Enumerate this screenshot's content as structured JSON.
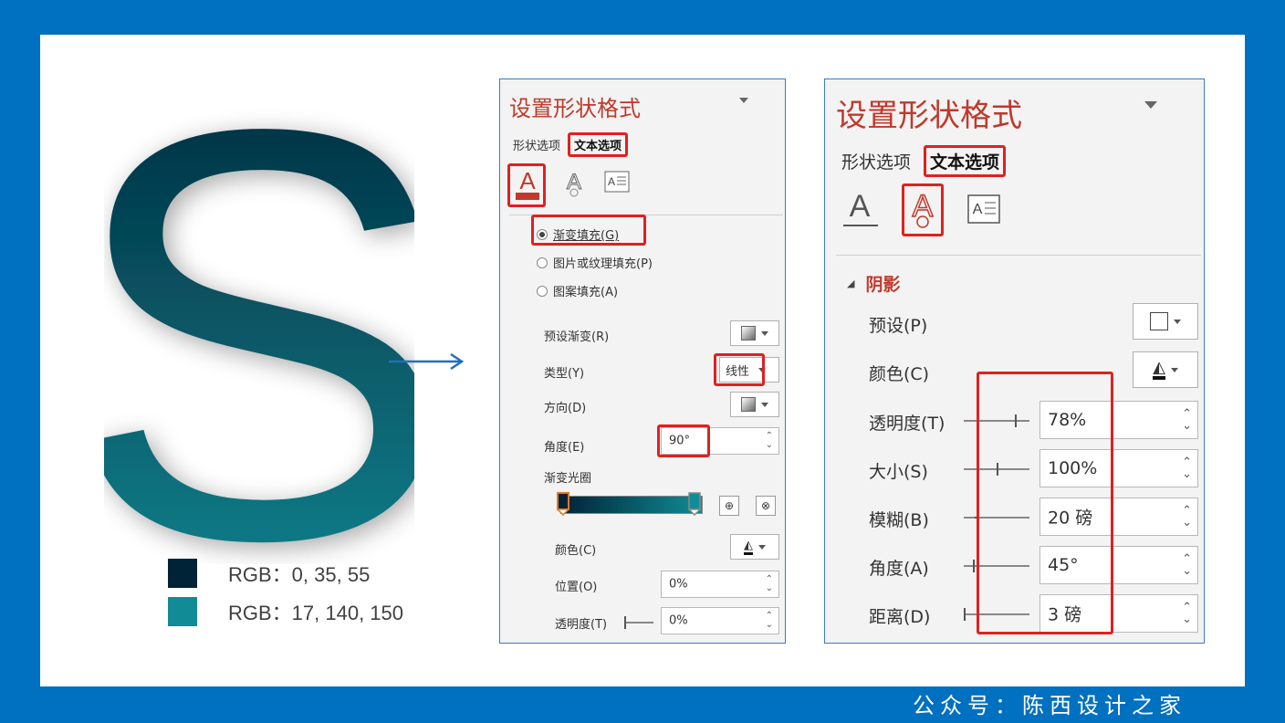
{
  "footer": "公众号：陈西设计之家",
  "legend": [
    {
      "color": "#002337",
      "label": "RGB：0, 35, 55"
    },
    {
      "color": "#118c96",
      "label": "RGB：17, 140, 150"
    }
  ],
  "big_letter": "S",
  "panel1": {
    "title": "设置形状格式",
    "tab_shape": "形状选项",
    "tab_text": "文本选项",
    "fills": [
      "渐变填充(G)",
      "图片或纹理填充(P)",
      "图案填充(A)"
    ],
    "preset_label": "预设渐变(R)",
    "type_label": "类型(Y)",
    "type_value": "线性",
    "direction_label": "方向(D)",
    "angle_label": "角度(E)",
    "angle_value": "90°",
    "stops_label": "渐变光圈",
    "color_label": "颜色(C)",
    "position_label": "位置(O)",
    "position_value": "0%",
    "transparency_label": "透明度(T)",
    "transparency_value": "0%"
  },
  "panel2": {
    "title": "设置形状格式",
    "tab_shape": "形状选项",
    "tab_text": "文本选项",
    "section": "阴影",
    "preset_label": "预设(P)",
    "color_label": "颜色(C)",
    "transparency_label": "透明度(T)",
    "transparency_value": "78%",
    "size_label": "大小(S)",
    "size_value": "100%",
    "blur_label": "模糊(B)",
    "blur_value": "20 磅",
    "angle_label": "角度(A)",
    "angle_value": "45°",
    "distance_label": "距离(D)",
    "distance_value": "3 磅"
  }
}
